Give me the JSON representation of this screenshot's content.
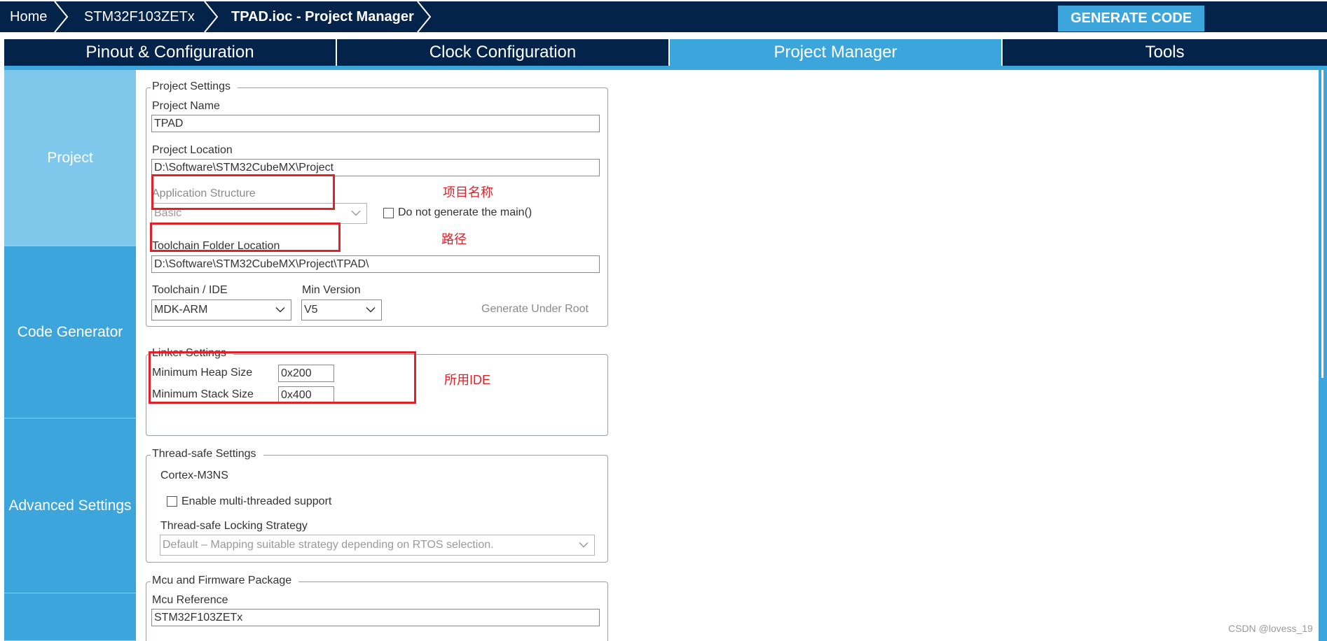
{
  "breadcrumb": {
    "items": [
      "Home",
      "STM32F103ZETx",
      "TPAD.ioc - Project Manager"
    ]
  },
  "toolbar": {
    "generate_label": "GENERATE CODE"
  },
  "tabs": [
    {
      "label": "Pinout & Configuration"
    },
    {
      "label": "Clock Configuration"
    },
    {
      "label": "Project Manager",
      "active": true
    },
    {
      "label": "Tools"
    }
  ],
  "sidenav": {
    "items": [
      {
        "label": "Project",
        "active": true
      },
      {
        "label": "Code Generator"
      },
      {
        "label": "Advanced Settings"
      },
      {
        "label": ""
      }
    ]
  },
  "project_settings": {
    "legend": "Project Settings",
    "name_label": "Project Name",
    "name_value": "TPAD",
    "location_label": "Project Location",
    "location_value": "D:\\Software\\STM32CubeMX\\Project",
    "app_structure_label": "Application Structure",
    "app_structure_value": "Basic",
    "no_main_label": "Do not generate the main()",
    "toolchain_folder_label": "Toolchain Folder Location",
    "toolchain_folder_value": "D:\\Software\\STM32CubeMX\\Project\\TPAD\\",
    "toolchain_label": "Toolchain / IDE",
    "toolchain_value": "MDK-ARM",
    "min_version_label": "Min Version",
    "min_version_value": "V5",
    "generate_under_root_label": "Generate Under Root"
  },
  "linker_settings": {
    "legend": "Linker Settings",
    "heap_label": "Minimum Heap Size",
    "heap_value": "0x200",
    "stack_label": "Minimum Stack Size",
    "stack_value": "0x400"
  },
  "thread_safe_settings": {
    "legend": "Thread-safe Settings",
    "core_label": "Cortex-M3NS",
    "multithread_label": "Enable multi-threaded support",
    "strategy_label": "Thread-safe Locking Strategy",
    "strategy_value": "Default  –  Mapping suitable strategy depending on RTOS selection."
  },
  "mcu_firmware": {
    "legend": "Mcu and Firmware Package",
    "mcu_ref_label": "Mcu Reference",
    "mcu_ref_value": "STM32F103ZETx"
  },
  "annotations": {
    "project_name_note": "项目名称",
    "path_note": "路径",
    "ide_note": "所用IDE"
  },
  "watermark": "CSDN @lovess_19",
  "colors": {
    "navy": "#03234b",
    "accent": "#3ca5dc",
    "accent_light": "#7fc8ec",
    "annotation_red": "#e0212a"
  }
}
